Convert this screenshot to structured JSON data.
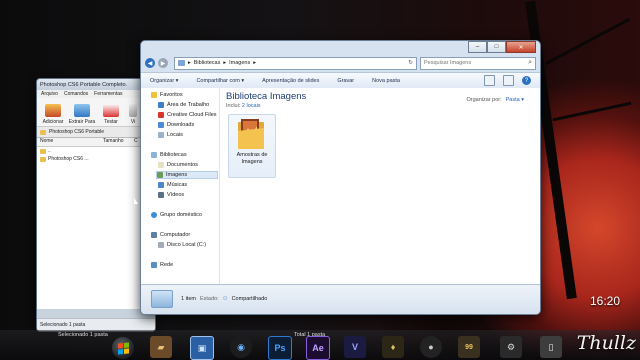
{
  "back_window": {
    "title": "Photoshop CS6 Portable Completo.",
    "menu": [
      "Arquivo",
      "Comandos",
      "Ferramentas"
    ],
    "tools": [
      "Adicionar",
      "Extrair Para",
      "Testar",
      "Vi"
    ],
    "path": "Photoshop CS6 Portable",
    "columns": [
      "Nome",
      "Tamanho",
      "C"
    ],
    "rows": [
      "..",
      "Photoshop CS6 ..."
    ],
    "status": "Selecionado 1 pasta"
  },
  "explorer": {
    "window_controls": {
      "minimize": "–",
      "maximize": "□",
      "close": "✕"
    },
    "breadcrumb": [
      "Bibliotecas",
      "Imagens"
    ],
    "search_placeholder": "Pesquisar Imagens",
    "toolbar": [
      "Organizar ▾",
      "Compartilhar com ▾",
      "Apresentação de slides",
      "Gravar",
      "Nova pasta"
    ],
    "nav": {
      "favorites_header": "Favoritos",
      "favorites": [
        "Área de Trabalho",
        "Creative Cloud Files",
        "Downloads",
        "Locais"
      ],
      "libraries_header": "Bibliotecas",
      "libraries": [
        "Documentos",
        "Imagens",
        "Músicas",
        "Vídeos"
      ],
      "homegroup": "Grupo doméstico",
      "computer_header": "Computador",
      "computer": [
        "Disco Local (C:)"
      ],
      "network": "Rede"
    },
    "content": {
      "title": "Biblioteca Imagens",
      "includes_label": "Inclui:",
      "includes_link": "2 locais",
      "arrange_label": "Organizar por:",
      "arrange_value": "Pasta ▾",
      "item_label": "Amostras de Imagens"
    },
    "details": {
      "count": "1 item",
      "state_label": "Estado:",
      "state_value": "Compartilhado"
    }
  },
  "taskbar": {
    "left_status": "Selecionado 1 pasta",
    "mid_status": "Total 1 pasta",
    "apps": [
      "Ps",
      "Ae",
      "V",
      "99"
    ]
  },
  "clock": "16:20",
  "signature": "Thullz",
  "colors": {
    "accent": "#2d6fc0",
    "close_button": "#c6432a",
    "title_text": "#1e3e74",
    "desktop_red": "#a8261c"
  }
}
